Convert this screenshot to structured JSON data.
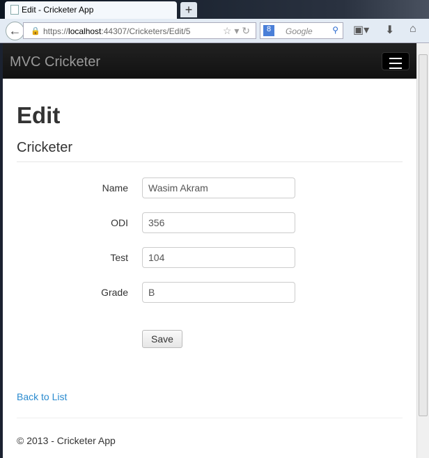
{
  "browser": {
    "tab_title": "Edit - Cricketer App",
    "new_tab": "+",
    "url_prefix": "https://",
    "url_host": "localhost",
    "url_rest": ":44307/Cricketers/Edit/5",
    "search_engine": "8",
    "search_placeholder": "Google"
  },
  "app": {
    "brand": "MVC Cricketer"
  },
  "page": {
    "title": "Edit",
    "subtitle": "Cricketer",
    "fields": [
      {
        "label": "Name",
        "value": "Wasim Akram"
      },
      {
        "label": "ODI",
        "value": "356"
      },
      {
        "label": "Test",
        "value": "104"
      },
      {
        "label": "Grade",
        "value": "B"
      }
    ],
    "save_label": "Save",
    "back_label": "Back to List",
    "footer": "© 2013 - Cricketer App"
  }
}
